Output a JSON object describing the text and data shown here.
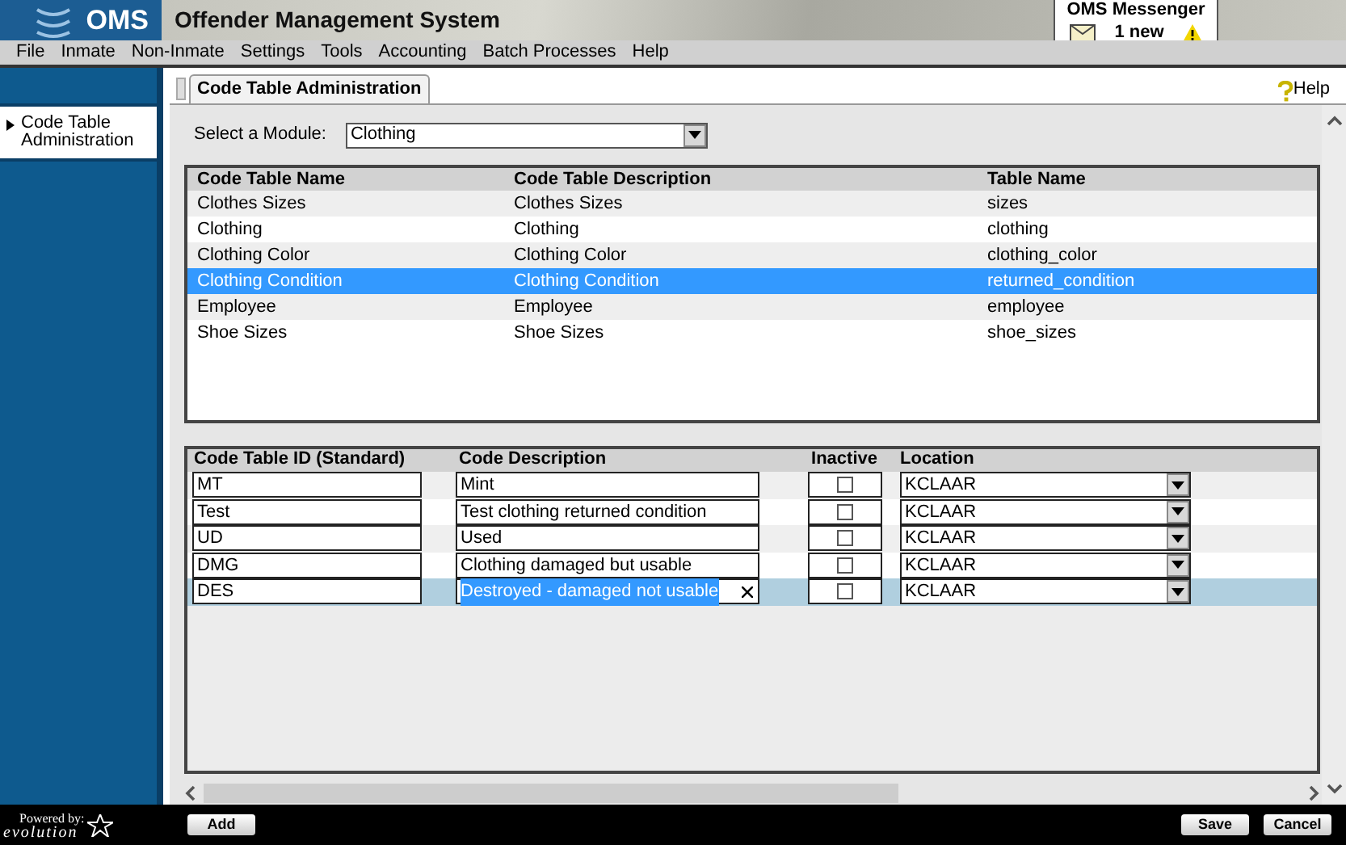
{
  "header": {
    "logo": "OMS",
    "title": "Offender Management System",
    "messenger": {
      "title": "OMS Messenger",
      "count": "1 new"
    }
  },
  "menu": [
    "File",
    "Inmate",
    "Non-Inmate",
    "Settings",
    "Tools",
    "Accounting",
    "Batch Processes",
    "Help"
  ],
  "sidebar": {
    "items": [
      {
        "label": "Code Table Administration",
        "selected": true
      }
    ]
  },
  "tabs": [
    {
      "label": "Code Table Administration",
      "selected": true
    }
  ],
  "help": "Help",
  "module": {
    "label": "Select a Module:",
    "value": "Clothing"
  },
  "code_tables": {
    "columns": [
      "Code Table Name",
      "Code Table Description",
      "Table Name"
    ],
    "rows": [
      {
        "cells": [
          "Clothes Sizes",
          "Clothes Sizes",
          "sizes"
        ],
        "selected": false
      },
      {
        "cells": [
          "Clothing",
          "Clothing",
          "clothing"
        ],
        "selected": false
      },
      {
        "cells": [
          "Clothing Color",
          "Clothing Color",
          "clothing_color"
        ],
        "selected": false
      },
      {
        "cells": [
          "Clothing Condition",
          "Clothing Condition",
          "returned_condition"
        ],
        "selected": true
      },
      {
        "cells": [
          "Employee",
          "Employee",
          "employee"
        ],
        "selected": false
      },
      {
        "cells": [
          "Shoe Sizes",
          "Shoe Sizes",
          "shoe_sizes"
        ],
        "selected": false
      }
    ]
  },
  "codes": {
    "columns": [
      "Code Table ID (Standard)",
      "Code Description",
      "Inactive",
      "Location"
    ],
    "rows": [
      {
        "id": "MT",
        "description": "Mint",
        "inactive": false,
        "location": "KCLAAR",
        "selected": false
      },
      {
        "id": "Test",
        "description": "Test clothing returned condition",
        "inactive": false,
        "location": "KCLAAR",
        "selected": false
      },
      {
        "id": "UD",
        "description": "Used",
        "inactive": false,
        "location": "KCLAAR",
        "selected": false
      },
      {
        "id": "DMG",
        "description": "Clothing damaged but usable",
        "inactive": false,
        "location": "KCLAAR",
        "selected": false
      },
      {
        "id": "DES",
        "description": "Destroyed - damaged not usable",
        "inactive": false,
        "location": "KCLAAR",
        "selected": true
      }
    ]
  },
  "footer": {
    "powered_by": "Powered by:",
    "brand": "evolution",
    "add": "Add",
    "buttons": [
      "Save",
      "Cancel"
    ]
  }
}
